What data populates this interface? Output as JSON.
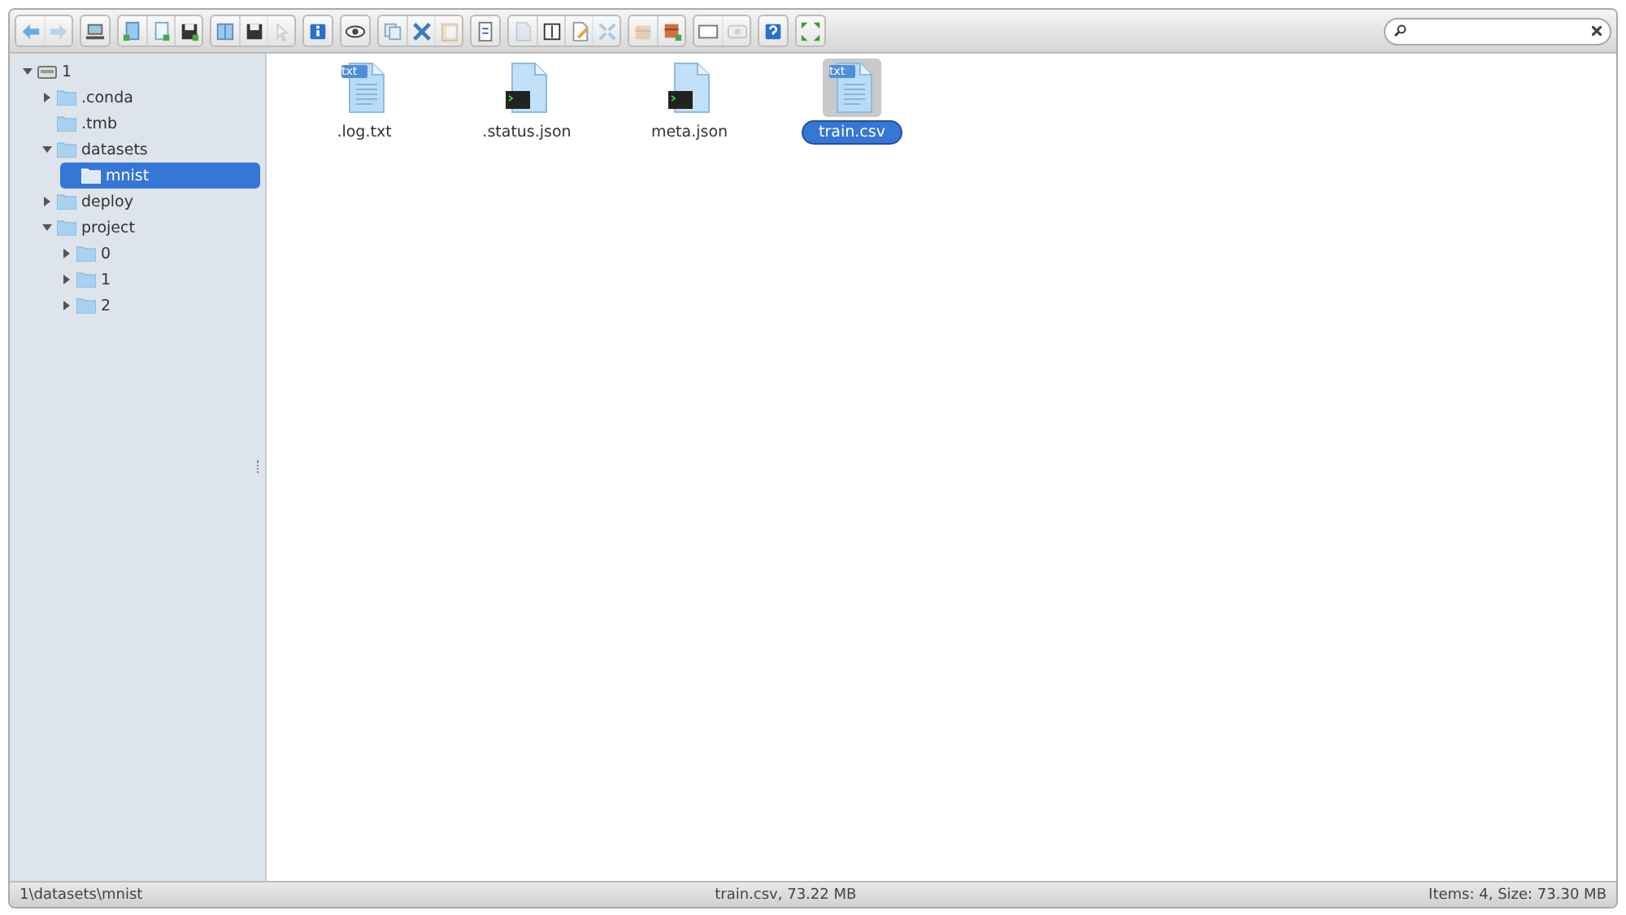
{
  "toolbar": [
    [
      {
        "kind": "back",
        "disabled": false
      },
      {
        "kind": "forward",
        "disabled": true
      }
    ],
    [
      {
        "kind": "computer",
        "disabled": false
      }
    ],
    [
      {
        "kind": "newfolder",
        "disabled": false
      },
      {
        "kind": "newfile",
        "disabled": false
      },
      {
        "kind": "upload",
        "disabled": false
      }
    ],
    [
      {
        "kind": "open",
        "disabled": false
      },
      {
        "kind": "save",
        "disabled": false
      },
      {
        "kind": "pointer",
        "disabled": true
      }
    ],
    [
      {
        "kind": "info",
        "disabled": false
      }
    ],
    [
      {
        "kind": "eye",
        "disabled": false
      }
    ],
    [
      {
        "kind": "copy",
        "disabled": false
      },
      {
        "kind": "cut",
        "disabled": false
      },
      {
        "kind": "paste",
        "disabled": true
      }
    ],
    [
      {
        "kind": "remove",
        "disabled": false
      }
    ],
    [
      {
        "kind": "duplicate",
        "disabled": true
      },
      {
        "kind": "rename",
        "disabled": false
      },
      {
        "kind": "edit",
        "disabled": false
      },
      {
        "kind": "resize",
        "disabled": true
      }
    ],
    [
      {
        "kind": "extract",
        "disabled": true
      },
      {
        "kind": "archive",
        "disabled": false
      }
    ],
    [
      {
        "kind": "view",
        "disabled": false
      },
      {
        "kind": "sort",
        "disabled": true
      }
    ],
    [
      {
        "kind": "help",
        "disabled": false
      }
    ],
    [
      {
        "kind": "fullscreen",
        "disabled": false
      }
    ]
  ],
  "search": {
    "clear_button": true
  },
  "tree": [
    {
      "label": "1",
      "kind": "drive",
      "expanded": true,
      "selected": false,
      "children": [
        {
          "label": ".conda",
          "expanded": false,
          "selected": false
        },
        {
          "label": ".tmb",
          "selected": false
        },
        {
          "label": "datasets",
          "expanded": true,
          "selected": false,
          "children": [
            {
              "label": "mnist",
              "selected": true
            }
          ]
        },
        {
          "label": "deploy",
          "expanded": false,
          "selected": false
        },
        {
          "label": "project",
          "expanded": true,
          "selected": false,
          "children": [
            {
              "label": "0",
              "expanded": false,
              "selected": false
            },
            {
              "label": "1",
              "expanded": false,
              "selected": false
            },
            {
              "label": "2",
              "expanded": false,
              "selected": false
            }
          ]
        }
      ]
    }
  ],
  "files": [
    {
      "name": ".log.txt",
      "kind": "text",
      "badge": "txt",
      "selected": false
    },
    {
      "name": ".status.json",
      "kind": "script",
      "selected": false
    },
    {
      "name": "meta.json",
      "kind": "script",
      "selected": false
    },
    {
      "name": "train.csv",
      "kind": "text",
      "badge": "txt",
      "selected": true
    }
  ],
  "status_bar": {
    "path": "1\\datasets\\mnist",
    "selection": "train.csv, 73.22 MB",
    "summary": "Items: 4, Size: 73.30 MB"
  }
}
